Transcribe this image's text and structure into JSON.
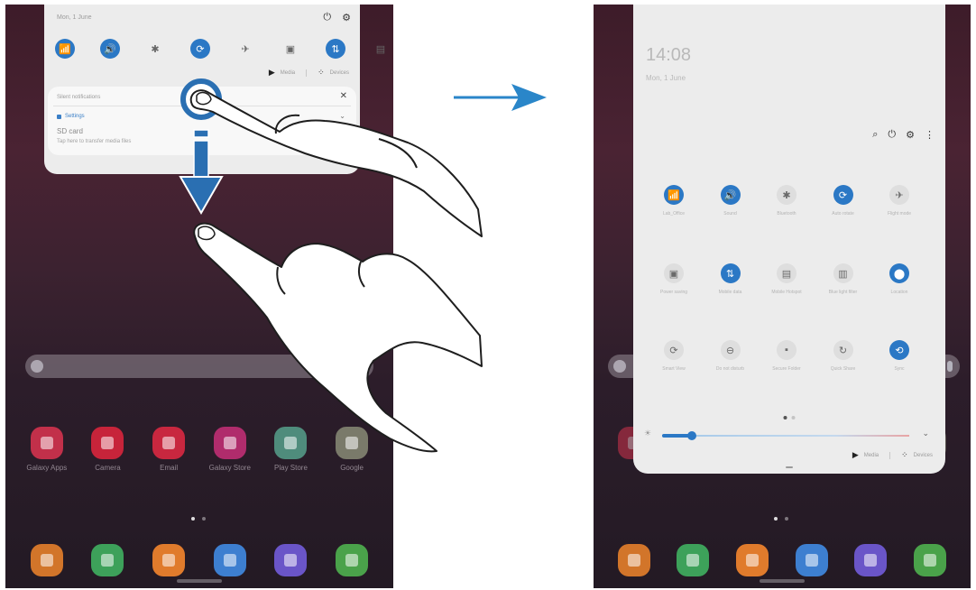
{
  "left_screen": {
    "panel": {
      "date": "Mon, 1 June",
      "quick_toggles": [
        {
          "icon": "wifi-icon",
          "glyph": "📶",
          "on": true
        },
        {
          "icon": "sound-icon",
          "glyph": "🔊",
          "on": true
        },
        {
          "icon": "bluetooth-icon",
          "glyph": "✱",
          "on": false
        },
        {
          "icon": "auto-rotate-icon",
          "glyph": "⟳",
          "on": true
        },
        {
          "icon": "airplane-icon",
          "glyph": "✈",
          "on": false
        },
        {
          "icon": "power-saving-icon",
          "glyph": "▣",
          "on": false
        },
        {
          "icon": "mobile-data-icon",
          "glyph": "⇅",
          "on": true
        },
        {
          "icon": "mobile-hotspot-icon",
          "glyph": "▤",
          "on": false
        }
      ],
      "media_label": "Media",
      "devices_label": "Devices",
      "notification": {
        "header": "Silent notifications",
        "app": "Settings",
        "title": "SD card",
        "text": "Tap here to transfer media files"
      }
    },
    "apps": [
      {
        "label": "Galaxy Apps",
        "color": "#c2304a"
      },
      {
        "label": "Camera",
        "color": "#c7243a"
      },
      {
        "label": "Email",
        "color": "#c8273f"
      },
      {
        "label": "Galaxy Store",
        "color": "#b02c6c"
      },
      {
        "label": "Play Store",
        "color": "#4f8c7c"
      },
      {
        "label": "Google",
        "color": "#7a7a6a"
      }
    ],
    "dock": [
      {
        "label": "",
        "color": "#d2752a"
      },
      {
        "label": "",
        "color": "#3da15a"
      },
      {
        "label": "",
        "color": "#e07b2c"
      },
      {
        "label": "",
        "color": "#3d7fd0"
      },
      {
        "label": "",
        "color": "#6a55c8"
      },
      {
        "label": "",
        "color": "#4aa24a"
      }
    ]
  },
  "right_screen": {
    "panel": {
      "clock": "14:08",
      "date": "Mon, 1 June",
      "rows": [
        [
          {
            "icon": "wifi-icon",
            "glyph": "📶",
            "on": true,
            "label": "Lab_Office"
          },
          {
            "icon": "sound-icon",
            "glyph": "🔊",
            "on": true,
            "label": "Sound"
          },
          {
            "icon": "bluetooth-icon",
            "glyph": "✱",
            "on": false,
            "label": "Bluetooth"
          },
          {
            "icon": "auto-rotate-icon",
            "glyph": "⟳",
            "on": true,
            "label": "Auto rotate"
          },
          {
            "icon": "airplane-icon",
            "glyph": "✈",
            "on": false,
            "label": "Flight mode"
          }
        ],
        [
          {
            "icon": "power-saving-icon",
            "glyph": "▣",
            "on": false,
            "label": "Power saving"
          },
          {
            "icon": "mobile-data-icon",
            "glyph": "⇅",
            "on": true,
            "label": "Mobile data"
          },
          {
            "icon": "mobile-hotspot-icon",
            "glyph": "▤",
            "on": false,
            "label": "Mobile Hotspot"
          },
          {
            "icon": "blue-light-icon",
            "glyph": "▥",
            "on": false,
            "label": "Blue light filter"
          },
          {
            "icon": "location-icon",
            "glyph": "⬤",
            "on": true,
            "label": "Location"
          }
        ],
        [
          {
            "icon": "smart-view-icon",
            "glyph": "⟳",
            "on": false,
            "label": "Smart View"
          },
          {
            "icon": "do-not-disturb-icon",
            "glyph": "⊖",
            "on": false,
            "label": "Do not disturb"
          },
          {
            "icon": "secure-folder-icon",
            "glyph": "▪",
            "on": false,
            "label": "Secure Folder"
          },
          {
            "icon": "quick-share-icon",
            "glyph": "↻",
            "on": false,
            "label": "Quick Share"
          },
          {
            "icon": "sync-icon",
            "glyph": "⟲",
            "on": true,
            "label": "Sync"
          }
        ]
      ],
      "media_label": "Media",
      "devices_label": "Devices",
      "brightness": 0.12
    },
    "dock": [
      {
        "label": "",
        "color": "#d2752a"
      },
      {
        "label": "",
        "color": "#3da15a"
      },
      {
        "label": "",
        "color": "#e07b2c"
      },
      {
        "label": "",
        "color": "#3d7fd0"
      },
      {
        "label": "",
        "color": "#6a55c8"
      },
      {
        "label": "",
        "color": "#4aa24a"
      }
    ]
  },
  "colors": {
    "accent": "#2b78c5",
    "arrow": "#2a86c9"
  }
}
